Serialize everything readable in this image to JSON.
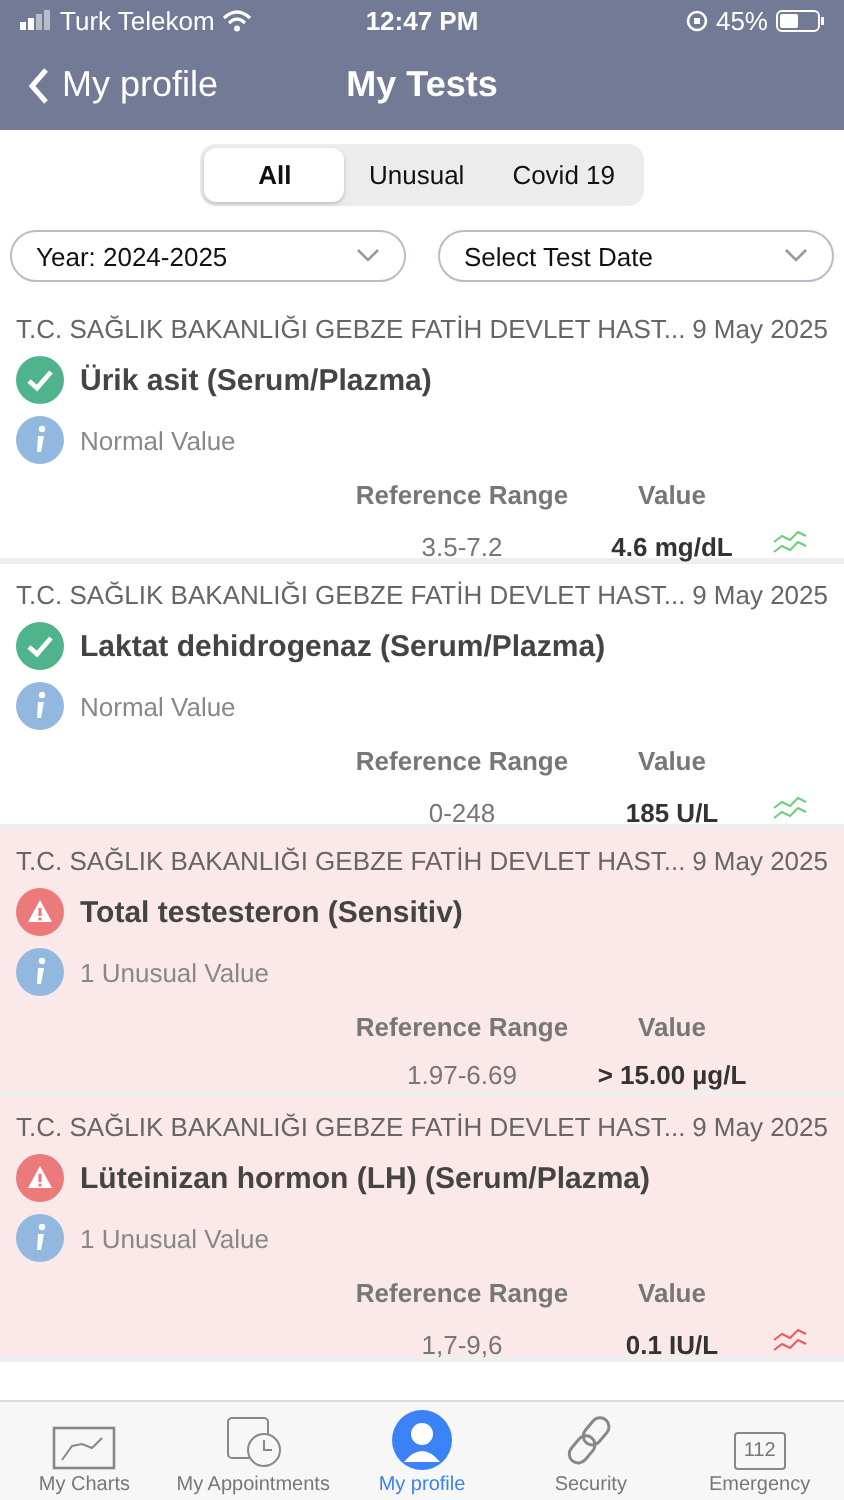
{
  "status_bar": {
    "carrier": "Turk Telekom",
    "time": "12:47 PM",
    "battery": "45%"
  },
  "nav": {
    "back": "My profile",
    "title": "My Tests"
  },
  "segments": [
    {
      "label": "All",
      "selected": true
    },
    {
      "label": "Unusual",
      "selected": false
    },
    {
      "label": "Covid 19",
      "selected": false
    }
  ],
  "filters": [
    {
      "value": "Year: 2024-2025"
    },
    {
      "value": "Select Test Date"
    }
  ],
  "tests": [
    {
      "hospital": "T.C. SAĞLIK BAKANLIĞI GEBZE FATİH DEVLET HAST...",
      "date": "9 May 2025",
      "name": "Ürik asit (Serum/Plazma)",
      "kind": "normal",
      "summary": "Normal Value",
      "range_label": "Reference Range",
      "value_label": "Value",
      "range": "3.5-7.2",
      "value": "4.6 mg/dL",
      "trend": true
    },
    {
      "hospital": "T.C. SAĞLIK BAKANLIĞI GEBZE FATİH DEVLET HAST...",
      "date": "9 May 2025",
      "name": "Laktat dehidrogenaz (Serum/Plazma)",
      "kind": "normal",
      "summary": "Normal Value",
      "range_label": "Reference Range",
      "value_label": "Value",
      "range": "0-248",
      "value": "185 U/L",
      "trend": true
    },
    {
      "hospital": "T.C. SAĞLIK BAKANLIĞI GEBZE FATİH DEVLET HAST...",
      "date": "9 May 2025",
      "name": "Total testesteron (Sensitiv)",
      "kind": "unusual",
      "summary": "1 Unusual Value",
      "range_label": "Reference Range",
      "value_label": "Value",
      "range": "1.97-6.69",
      "value": "> 15.00 µg/L",
      "trend": false
    },
    {
      "hospital": "T.C. SAĞLIK BAKANLIĞI GEBZE FATİH DEVLET HAST...",
      "date": "9 May 2025",
      "name": "Lüteinizan hormon (LH) (Serum/Plazma)",
      "kind": "unusual",
      "summary": "1 Unusual Value",
      "range_label": "Reference Range",
      "value_label": "Value",
      "range": "1,7-9,6",
      "value": "0.1 IU/L",
      "trend": true
    }
  ],
  "tab_bar": [
    {
      "label": "My Charts",
      "kind": "chart",
      "selected": false
    },
    {
      "label": "My Appointments",
      "kind": "calendar",
      "selected": false
    },
    {
      "label": "My profile",
      "kind": "person",
      "selected": true
    },
    {
      "label": "Security",
      "kind": "link",
      "selected": false
    },
    {
      "label": "Emergency",
      "kind": "emergency",
      "badge": "112",
      "selected": false
    }
  ]
}
